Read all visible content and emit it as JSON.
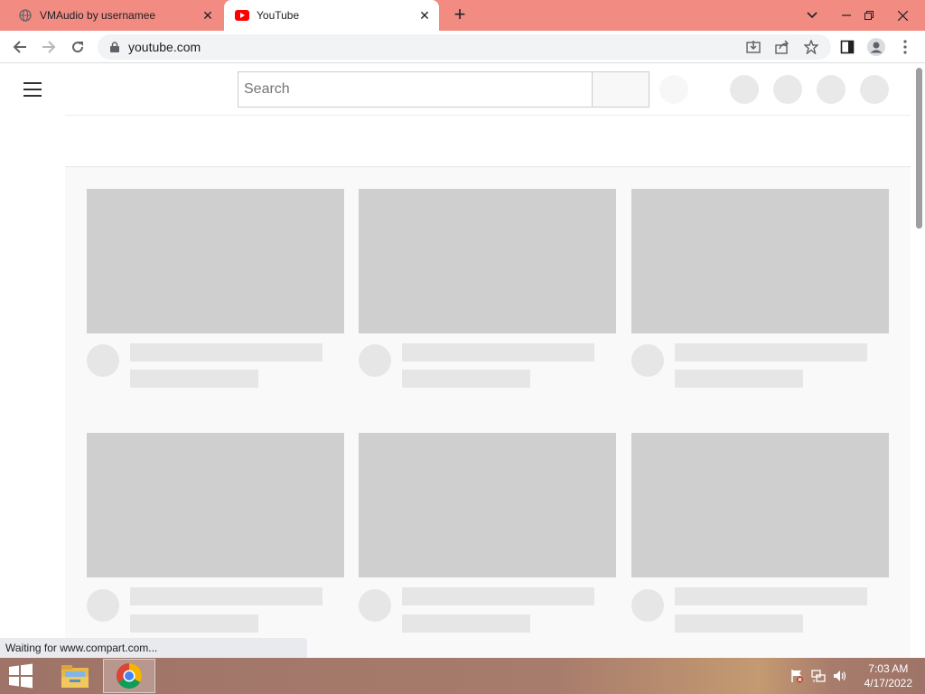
{
  "browser": {
    "tabs": [
      {
        "title": "VMAudio by usernamee",
        "icon": "globe-icon",
        "active": false
      },
      {
        "title": "YouTube",
        "icon": "youtube-icon",
        "active": true
      }
    ],
    "address": "youtube.com",
    "status_text": "Waiting for www.compart.com..."
  },
  "youtube": {
    "search_placeholder": "Search"
  },
  "taskbar": {
    "time": "7:03 AM",
    "date": "4/17/2022"
  },
  "colors": {
    "tabstrip": "#f28b82",
    "skeleton_thumb": "#cfcfcf",
    "skeleton_line": "#e6e6e6"
  }
}
